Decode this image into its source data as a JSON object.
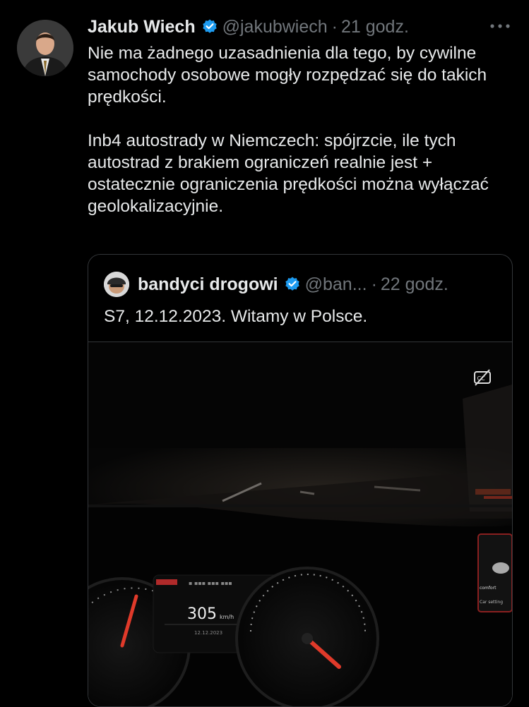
{
  "tweet": {
    "author_name": "Jakub Wiech",
    "handle": "@jakubwiech",
    "separator": "·",
    "time": "21 godz.",
    "more_icon": "more-horizontal-icon",
    "paragraphs": [
      "Nie ma żadnego uzasadnienia dla tego, by cywilne samochody osobowe mogły rozpędzać się do takich prędkości.",
      "Inb4 autostrady w Niemczech: spójrzcie, ile tych autostrad z brakiem ograniczeń realnie jest + ostatecznie ograniczenia prędkości można wyłączać geolokalizacyjnie."
    ]
  },
  "quoted": {
    "author_name": "bandyci drogowi",
    "handle": "@ban...",
    "separator": "·",
    "time": "22 godz.",
    "text": "S7, 12.12.2023. Witamy w Polsce.",
    "video": {
      "speed": "305",
      "speed_unit": "km/h",
      "date": "12.12.2023",
      "screen_label_1": "comfort",
      "screen_label_2": "Car setting",
      "captions_icon": "closed-captions-off-icon"
    }
  },
  "colors": {
    "background": "#000000",
    "text": "#e7e9ea",
    "muted": "#71767b",
    "verified": "#1d9bf0",
    "border": "#333639"
  }
}
